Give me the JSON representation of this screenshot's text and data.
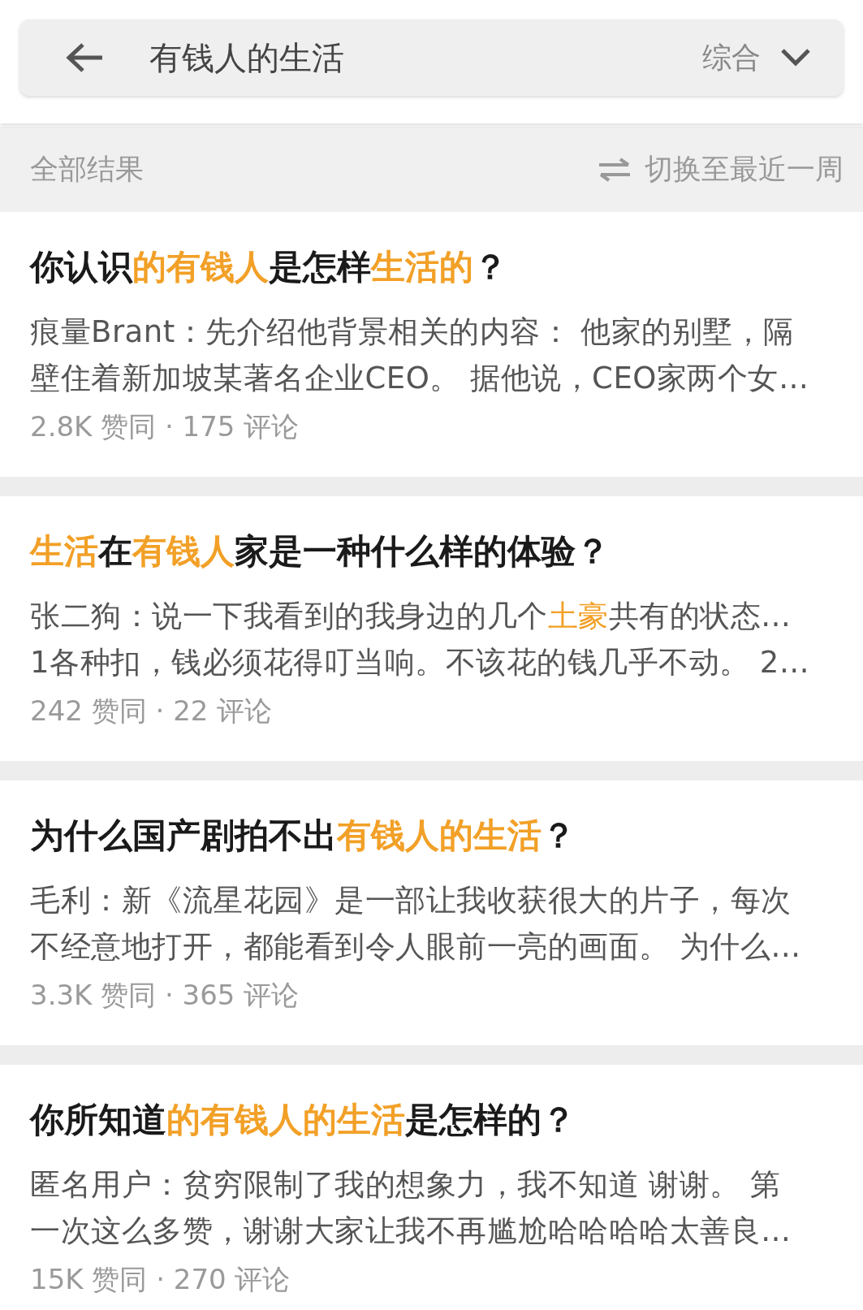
{
  "search_bar": {
    "query": "有钱人的生活",
    "filter": "综合"
  },
  "results_header": {
    "label": "全部结果",
    "switch": "切换至最近一周"
  },
  "results": [
    {
      "title": [
        {
          "text": "你认识",
          "highlight": false
        },
        {
          "text": "的有钱人",
          "highlight": true
        },
        {
          "text": "是怎样",
          "highlight": false
        },
        {
          "text": "生活的",
          "highlight": true
        },
        {
          "text": "？",
          "highlight": false
        }
      ],
      "excerpt_lines": [
        [
          {
            "text": "痕量Brant：先介绍他背景相关的内容： 他家的别墅，隔",
            "highlight": false
          }
        ],
        [
          {
            "text": "壁住着新加坡某著名企业CEO。 据他说，CEO家两个女…",
            "highlight": false
          }
        ]
      ],
      "meta": "2.8K 赞同 · 175 评论"
    },
    {
      "title": [
        {
          "text": "生活",
          "highlight": true
        },
        {
          "text": "在",
          "highlight": false
        },
        {
          "text": "有钱人",
          "highlight": true
        },
        {
          "text": "家是一种什么样的体验？",
          "highlight": false
        }
      ],
      "excerpt_lines": [
        [
          {
            "text": "张二狗：说一下我看到的我身边的几个",
            "highlight": false
          },
          {
            "text": "土豪",
            "highlight": true
          },
          {
            "text": "共有的状态…",
            "highlight": false
          }
        ],
        [
          {
            "text": "1各种扣，钱必须花得叮当响。不该花的钱几乎不动。 2…",
            "highlight": false
          }
        ]
      ],
      "meta": "242 赞同 · 22 评论"
    },
    {
      "title": [
        {
          "text": "为什么国产剧拍不出",
          "highlight": false
        },
        {
          "text": "有钱人的生活",
          "highlight": true
        },
        {
          "text": "？",
          "highlight": false
        }
      ],
      "excerpt_lines": [
        [
          {
            "text": "毛利：新《流星花园》是一部让我收获很大的片子，每次",
            "highlight": false
          }
        ],
        [
          {
            "text": "不经意地打开，都能看到令人眼前一亮的画面。 为什么…",
            "highlight": false
          }
        ]
      ],
      "meta": "3.3K 赞同 · 365 评论"
    },
    {
      "title": [
        {
          "text": "你所知道",
          "highlight": false
        },
        {
          "text": "的有钱人的生活",
          "highlight": true
        },
        {
          "text": "是怎样的？",
          "highlight": false
        }
      ],
      "excerpt_lines": [
        [
          {
            "text": "匿名用户：贫穷限制了我的想象力，我不知道 谢谢。 第",
            "highlight": false
          }
        ],
        [
          {
            "text": "一次这么多赞，谢谢大家让我不再尴尬哈哈哈哈太善良…",
            "highlight": false
          }
        ]
      ],
      "meta": "15K 赞同 · 270 评论"
    }
  ]
}
